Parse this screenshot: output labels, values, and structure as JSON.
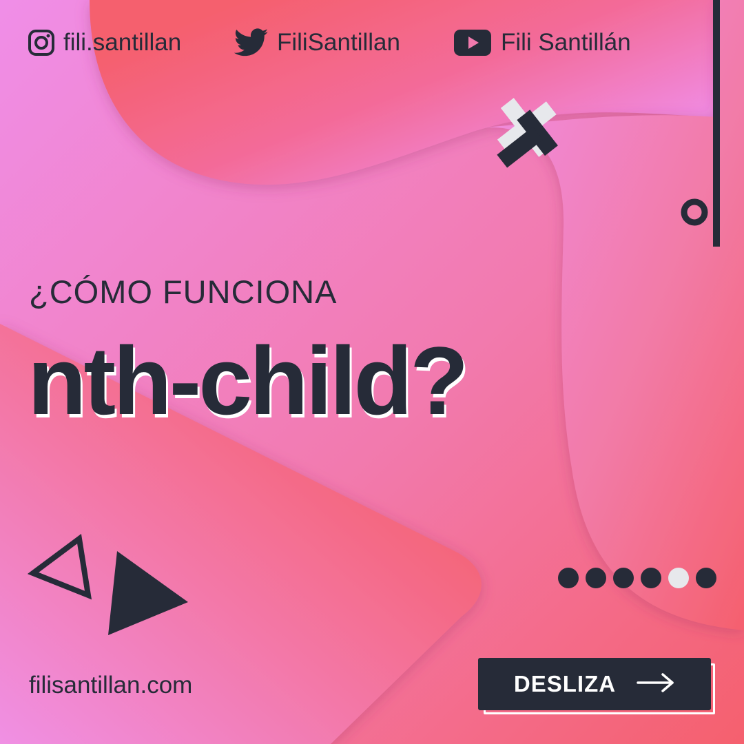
{
  "social": {
    "instagram": {
      "icon": "instagram-icon",
      "handle": "fili.santillan"
    },
    "twitter": {
      "icon": "twitter-bird-icon",
      "handle": "FiliSantillan"
    },
    "youtube": {
      "icon": "youtube-play-icon",
      "handle": "Fili Santillán"
    }
  },
  "title": {
    "question": "¿CÓMO FUNCIONA",
    "headline": "nth-child?"
  },
  "website": "filisantillan.com",
  "cta": {
    "label": "DESLIZA",
    "icon": "arrow-right-icon"
  },
  "pagination": {
    "total": 6,
    "current": 5
  },
  "colors": {
    "dark": "#262b38",
    "pink": "#f08ee8",
    "coral": "#f55a6b",
    "light": "#e7e8ec"
  }
}
